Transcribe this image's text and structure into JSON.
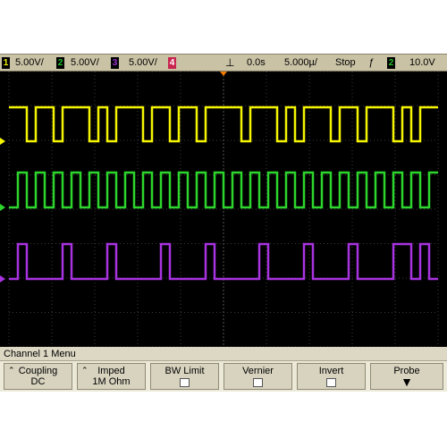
{
  "topbar": {
    "channels": [
      {
        "num": "1",
        "scale": "5.00V/",
        "color": "#f5f500"
      },
      {
        "num": "2",
        "scale": "5.00V/",
        "color": "#22c22a"
      },
      {
        "num": "3",
        "scale": "5.00V/",
        "color": "#9a2fd0"
      },
      {
        "num": "4",
        "scale": "",
        "color": "#c9244f"
      }
    ],
    "trigger_pos": "0.0s",
    "timebase": "5.000µ/",
    "run_state": "Stop",
    "trigger_symbol": "⨍",
    "trigger_channel": "2",
    "trigger_level": "10.0V"
  },
  "traces": {
    "colors": {
      "ch1": "#f5f500",
      "ch2": "#2dd62d",
      "ch3": "#a833e0",
      "grid": "#3a3a3a"
    },
    "ch1_bits": [
      1,
      1,
      0,
      1,
      1,
      0,
      1,
      1,
      1,
      0,
      1,
      0,
      1,
      1,
      1,
      0,
      1,
      1,
      0,
      1,
      1,
      0,
      1,
      1,
      1,
      1,
      0,
      1,
      1,
      1,
      0,
      1,
      0,
      1,
      1,
      1,
      0,
      1,
      1,
      0,
      1,
      1,
      1,
      0,
      1,
      0,
      1,
      1
    ],
    "ch2_bits": [
      0,
      1,
      0,
      1,
      0,
      1,
      0,
      1,
      0,
      1,
      0,
      1,
      0,
      1,
      0,
      1,
      0,
      1,
      0,
      1,
      0,
      1,
      0,
      1,
      0,
      1,
      0,
      1,
      0,
      1,
      0,
      1,
      0,
      1,
      0,
      1,
      0,
      1,
      0,
      1,
      0,
      1,
      0,
      1,
      0,
      1,
      0,
      1
    ],
    "ch3_pulses": [
      1,
      6,
      11,
      17,
      22,
      28,
      33,
      38,
      43,
      44,
      46
    ]
  },
  "menu": {
    "title": "Channel 1  Menu",
    "softkeys": [
      {
        "label": "Coupling",
        "value": "DC",
        "arrow": true
      },
      {
        "label": "Imped",
        "value": "1M Ohm",
        "arrow": true
      },
      {
        "label": "BW Limit",
        "value": "",
        "checkbox": true
      },
      {
        "label": "Vernier",
        "value": "",
        "checkbox": true
      },
      {
        "label": "Invert",
        "value": "",
        "checkbox": true
      },
      {
        "label": "Probe",
        "value": "▼"
      }
    ]
  }
}
